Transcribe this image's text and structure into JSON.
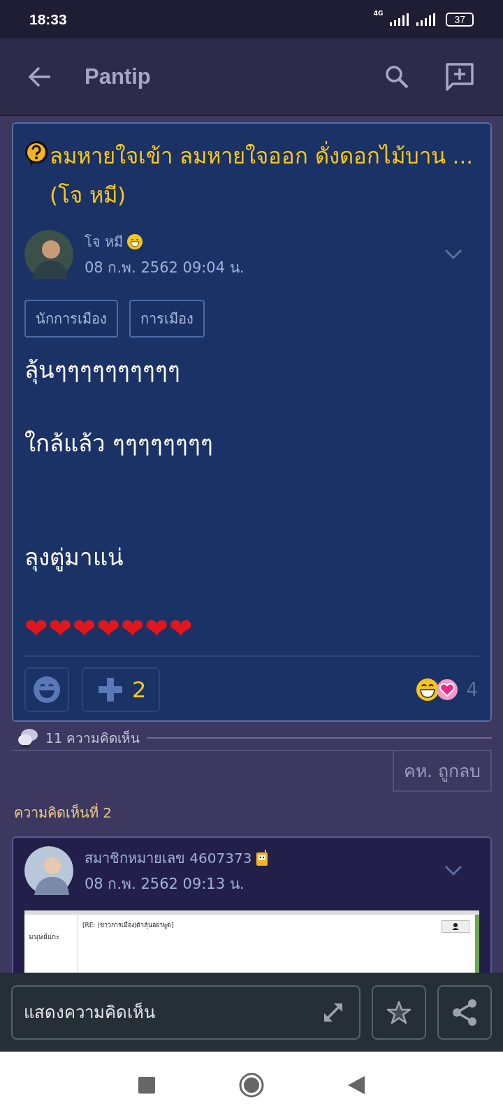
{
  "status_bar": {
    "time": "18:33",
    "network": "4G",
    "battery": "37"
  },
  "app_bar": {
    "title": "Pantip"
  },
  "topic": {
    "title": "ลมหายใจเข้า ลมหายใจออก ดั่งดอกไม้บาน ... (โจ หมี)",
    "author": "โจ หมี",
    "date": "08 ก.พ. 2562 09:04 น.",
    "tags": [
      "นักการเมือง",
      "การเมือง"
    ],
    "body": [
      "ลุ้นๆๆๆๆๆๆๆๆๆๆ",
      "ใกล้แล้ว ๆๆๆๆๆๆๆๆ",
      "ลุงตู่มาแน่",
      "❤❤❤❤❤❤❤"
    ],
    "plus_count": "2",
    "reaction_count": "4"
  },
  "comments_header": {
    "count": "11 ความคิดเห็น",
    "deleted_button": "คห. ถูกลบ"
  },
  "comment": {
    "label": "ความคิดเห็นที่ 2",
    "author": "สมาชิกหมายเลข 4607373",
    "date": "08 ก.พ. 2562 09:13 น.",
    "screenshot": {
      "heading": "[RE: (ข่าวการเมือง)ต้าลุ้นอย่าพูด]",
      "sidebar_text": "มนุษย์แกะ"
    }
  },
  "composer": {
    "placeholder": "แสดงความคิดเห็น"
  }
}
